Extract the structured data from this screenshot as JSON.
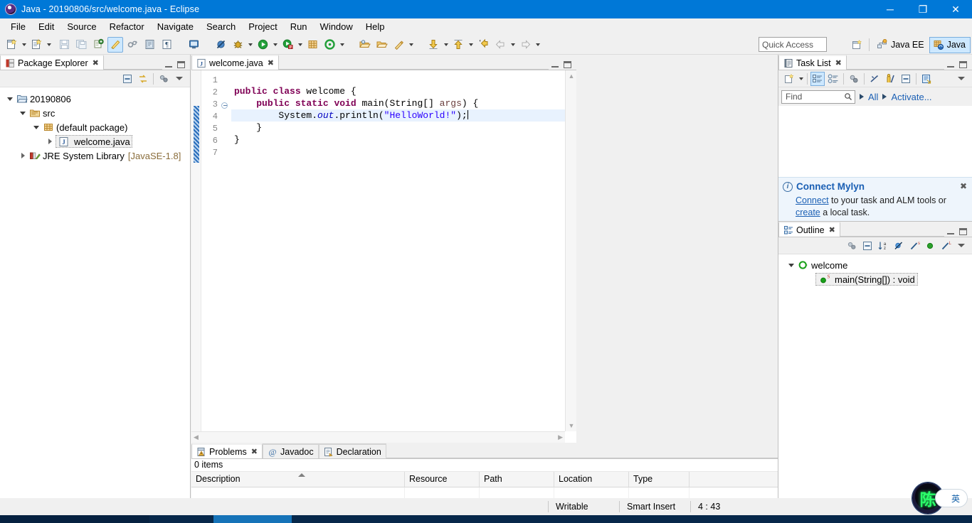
{
  "window": {
    "title": "Java - 20190806/src/welcome.java - Eclipse",
    "app_icon": "eclipse-icon",
    "controls": {
      "minimize": "─",
      "maximize": "❐",
      "close": "✕"
    },
    "titlebar_color": "#0078d7"
  },
  "menubar": {
    "items": [
      "File",
      "Edit",
      "Source",
      "Refactor",
      "Navigate",
      "Search",
      "Project",
      "Run",
      "Window",
      "Help"
    ]
  },
  "toolbar": {
    "groups": [
      {
        "name": "new-group",
        "buttons": [
          "new-wizard-icon",
          "new-java-class-icon"
        ]
      },
      {
        "name": "save-group",
        "buttons": [
          "save-icon",
          "save-all-icon"
        ]
      },
      {
        "name": "print-group",
        "buttons": [
          "print-icon",
          "toggle-markoccurrences-icon",
          "link-icon",
          "open-type-icon",
          "pilcrow-icon"
        ]
      },
      {
        "name": "console-group",
        "buttons": [
          "console-icon"
        ]
      },
      {
        "name": "debug-group",
        "buttons": [
          "skip-breakpoints-icon",
          "debug-icon",
          "run-icon",
          "run-coverage-icon",
          "new-java-project-icon",
          "external-tools-icon"
        ]
      },
      {
        "name": "search-group",
        "buttons": [
          "open-task-icon",
          "open-resource-icon",
          "search-icon"
        ]
      },
      {
        "name": "nav-group",
        "buttons": [
          "next-annotation-icon",
          "previous-annotation-icon",
          "last-edit-location-icon",
          "back-icon",
          "forward-icon"
        ]
      }
    ],
    "quick_access_placeholder": "Quick Access",
    "perspectives": [
      {
        "label": "Java EE",
        "icon": "java-ee-perspective-icon",
        "selected": false
      },
      {
        "label": "Java",
        "icon": "java-perspective-icon",
        "selected": true
      }
    ],
    "open_perspective_icon": "open-perspective-icon"
  },
  "package_explorer": {
    "tab_label": "Package Explorer",
    "tab_icon": "package-explorer-icon",
    "close_glyph": "✖",
    "toolbar_icons": [
      "collapse-all-icon",
      "link-with-editor-icon",
      "view-menu-filters-icon",
      "view-menu-icon"
    ],
    "tree": [
      {
        "depth": 0,
        "twisty": "down",
        "icon": "project-icon",
        "label": "20190806",
        "suffix": ""
      },
      {
        "depth": 1,
        "twisty": "down",
        "icon": "source-folder-icon",
        "label": "src",
        "suffix": ""
      },
      {
        "depth": 2,
        "twisty": "down",
        "icon": "package-icon",
        "label": "(default package)",
        "suffix": ""
      },
      {
        "depth": 3,
        "twisty": "right",
        "icon": "java-file-icon",
        "label": "welcome.java",
        "suffix": "",
        "selected": true
      },
      {
        "depth": 1,
        "twisty": "right",
        "icon": "jre-library-icon",
        "label": "JRE System Library",
        "suffix": "[JavaSE-1.8]"
      }
    ]
  },
  "editor": {
    "tab_label": "welcome.java",
    "tab_icon": "java-file-icon",
    "close_glyph": "✖",
    "minimize_title": "Minimize",
    "maximize_title": "Maximize",
    "lines": [
      {
        "no": "1",
        "segments": []
      },
      {
        "no": "2",
        "segments": [
          {
            "t": "kw",
            "s": "public "
          },
          {
            "t": "kw",
            "s": "class "
          },
          {
            "t": "pln",
            "s": "welcome {"
          }
        ]
      },
      {
        "no": "3",
        "fold": true,
        "segments": [
          {
            "t": "pln",
            "s": "    "
          },
          {
            "t": "kw",
            "s": "public "
          },
          {
            "t": "kw",
            "s": "static "
          },
          {
            "t": "kw",
            "s": "void "
          },
          {
            "t": "pln",
            "s": "main(String[] "
          },
          {
            "t": "prm",
            "s": "args"
          },
          {
            "t": "pln",
            "s": ") {"
          }
        ]
      },
      {
        "no": "4",
        "highlight": true,
        "caret": true,
        "segments": [
          {
            "t": "pln",
            "s": "        System."
          },
          {
            "t": "fld",
            "s": "out"
          },
          {
            "t": "pln",
            "s": ".println("
          },
          {
            "t": "str",
            "s": "\"HelloWorld!\""
          },
          {
            "t": "pln",
            "s": ");"
          }
        ]
      },
      {
        "no": "5",
        "segments": [
          {
            "t": "pln",
            "s": "    }"
          }
        ]
      },
      {
        "no": "6",
        "segments": [
          {
            "t": "pln",
            "s": "}"
          }
        ]
      },
      {
        "no": "7",
        "segments": []
      }
    ]
  },
  "problems": {
    "tabs": [
      {
        "label": "Problems",
        "icon": "problems-icon",
        "active": true,
        "close_glyph": "✖"
      },
      {
        "label": "Javadoc",
        "icon": "javadoc-at-icon",
        "active": false
      },
      {
        "label": "Declaration",
        "icon": "declaration-icon",
        "active": false
      }
    ],
    "toolbar_icons": [
      "view-menu-filters-icon",
      "view-menu-icon"
    ],
    "item_count_label": "0 items",
    "columns": [
      "Description",
      "Resource",
      "Path",
      "Location",
      "Type"
    ],
    "sorted_column": "Description",
    "rows": []
  },
  "task_list": {
    "tab_label": "Task List",
    "tab_icon": "task-list-icon",
    "close_glyph": "✖",
    "toolbar_icons": [
      "new-task-icon",
      "new-task-dropdown-icon",
      "categorized-presentation-icon",
      "scheduled-presentation-icon",
      "focus-on-workweek-icon",
      "synchronize-changed-icon",
      "collapse-all-icon",
      "restore-task-icon",
      "view-menu-icon"
    ],
    "find_placeholder": "Find",
    "find_icon": "search-icon",
    "filters": [
      {
        "label": "All",
        "arrow": "▶"
      },
      {
        "label": "Activate...",
        "arrow": "▶"
      }
    ],
    "mylyn": {
      "title": "Connect Mylyn",
      "info_icon": "info-icon",
      "close_glyph": "✖",
      "link1": "Connect",
      "text1": " to your task and ALM tools or ",
      "link2": "create",
      "text2": " a local task."
    }
  },
  "outline": {
    "tab_label": "Outline",
    "tab_icon": "outline-icon",
    "close_glyph": "✖",
    "toolbar_icons": [
      "focus-on-active-task-icon",
      "collapse-all-icon",
      "sort-icon",
      "hide-fields-icon",
      "hide-static-icon",
      "hide-nonpublic-icon",
      "hide-local-types-icon",
      "view-menu-icon"
    ],
    "tree": [
      {
        "depth": 0,
        "twisty": "down",
        "icon": "java-class-icon",
        "label": "welcome",
        "selected": false
      },
      {
        "depth": 1,
        "twisty": "none",
        "icon": "public-method-static-icon",
        "label": "main(String[]) : void",
        "selected": true
      }
    ]
  },
  "statusbar": {
    "writable": "Writable",
    "insert_mode": "Smart Insert",
    "cursor_position": "4 : 43",
    "ime": {
      "glyph": "陈",
      "mode": "英"
    }
  }
}
